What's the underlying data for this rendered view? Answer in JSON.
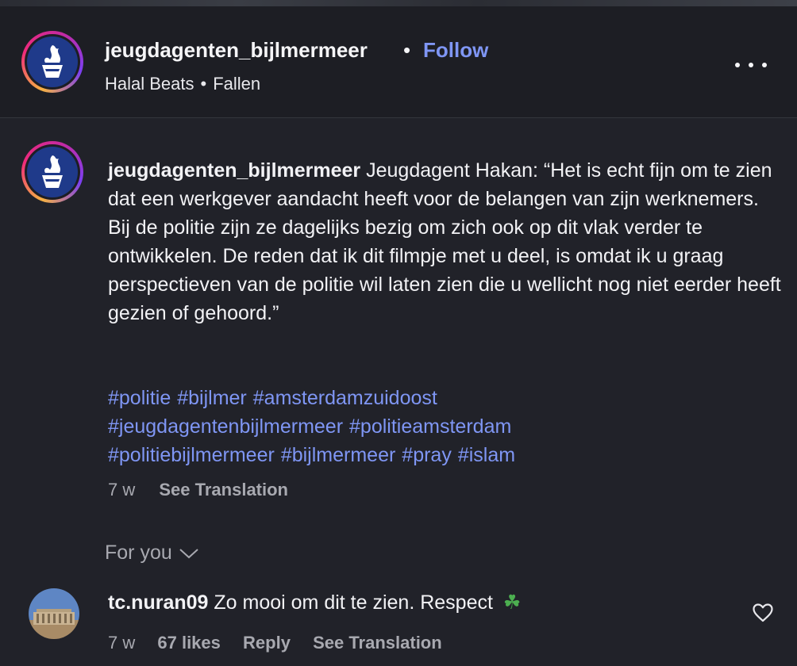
{
  "header": {
    "username": "jeugdagenten_bijlmermeer",
    "separator": "•",
    "follow_label": "Follow",
    "audio_artist": "Halal Beats",
    "audio_sep": "•",
    "audio_track": "Fallen",
    "more_icon": "more-horizontal-icon"
  },
  "caption": {
    "username": "jeugdagenten_bijlmermeer",
    "text": "Jeugdagent Hakan: “Het is echt fijn om te zien dat een werkgever aandacht heeft voor de belangen van zijn werknemers. Bij de politie zijn ze dagelijks bezig om zich ook op dit vlak verder te ontwikkelen. De reden dat ik dit filmpje met u deel, is omdat ik u graag perspectieven van de politie wil laten zien die u wellicht nog niet eerder heeft gezien of gehoord.”",
    "hashtags": [
      "#politie",
      "#bijlmer",
      "#amsterdamzuidoost",
      "#jeugdagentenbijlmermeer",
      "#politieamsterdam",
      "#politiebijlmermeer",
      "#bijlmermeer",
      "#pray",
      "#islam"
    ],
    "age": "7 w",
    "see_translation": "See Translation"
  },
  "sort": {
    "label": "For you"
  },
  "comment": {
    "username": "tc.nuran09",
    "text": "Zo mooi om dit te zien. Respect",
    "emoji": "☘",
    "age": "7 w",
    "likes": "67 likes",
    "reply": "Reply",
    "see_translation": "See Translation"
  },
  "colors": {
    "background": "#212229",
    "link_blue": "#7f96f4",
    "muted_text": "#a8a9b0",
    "police_blue": "#1f3a8a"
  }
}
